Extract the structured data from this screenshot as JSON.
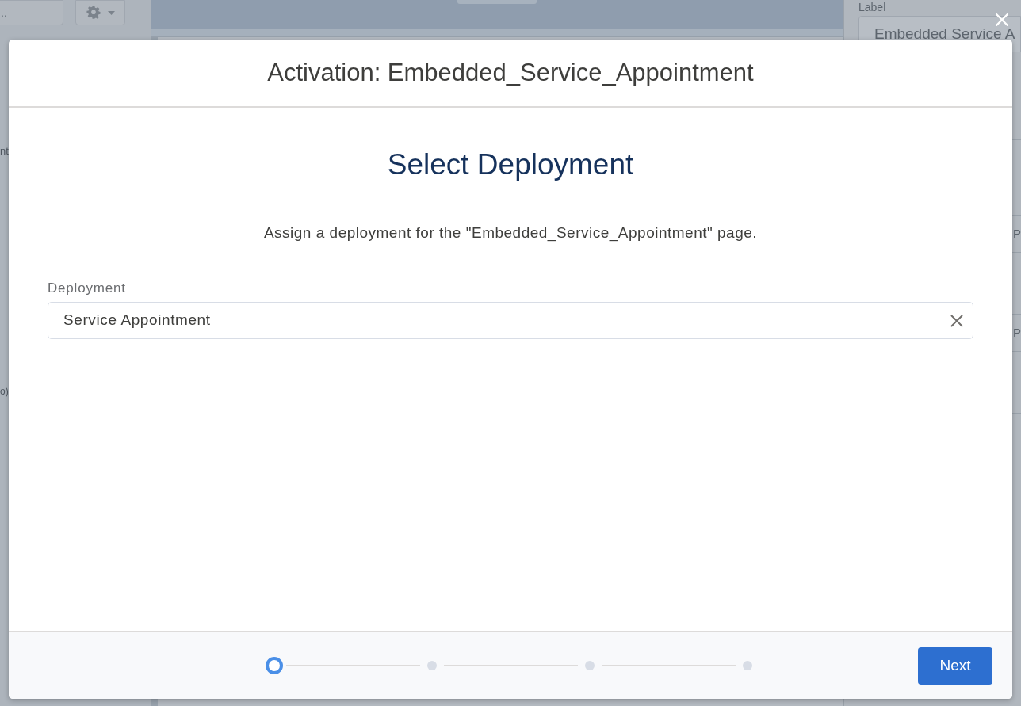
{
  "background": {
    "toolbar_button": {
      "label": ".."
    },
    "left_fragments": [
      "nt",
      "o)"
    ],
    "right_panel": {
      "field_label": "Label",
      "field_value": "Embedded Service A",
      "fragments": [
        "P",
        "P"
      ]
    }
  },
  "modal": {
    "title": "Activation: Embedded_Service_Appointment",
    "heading": "Select Deployment",
    "description": "Assign a deployment for the \"Embedded_Service_Appointment\" page.",
    "field": {
      "label": "Deployment",
      "value": "Service Appointment"
    },
    "steps": [
      {
        "selected": true
      },
      {
        "selected": false
      },
      {
        "selected": false
      },
      {
        "selected": false
      }
    ],
    "buttons": [
      {
        "label": "Next",
        "kind": "primary"
      }
    ]
  }
}
